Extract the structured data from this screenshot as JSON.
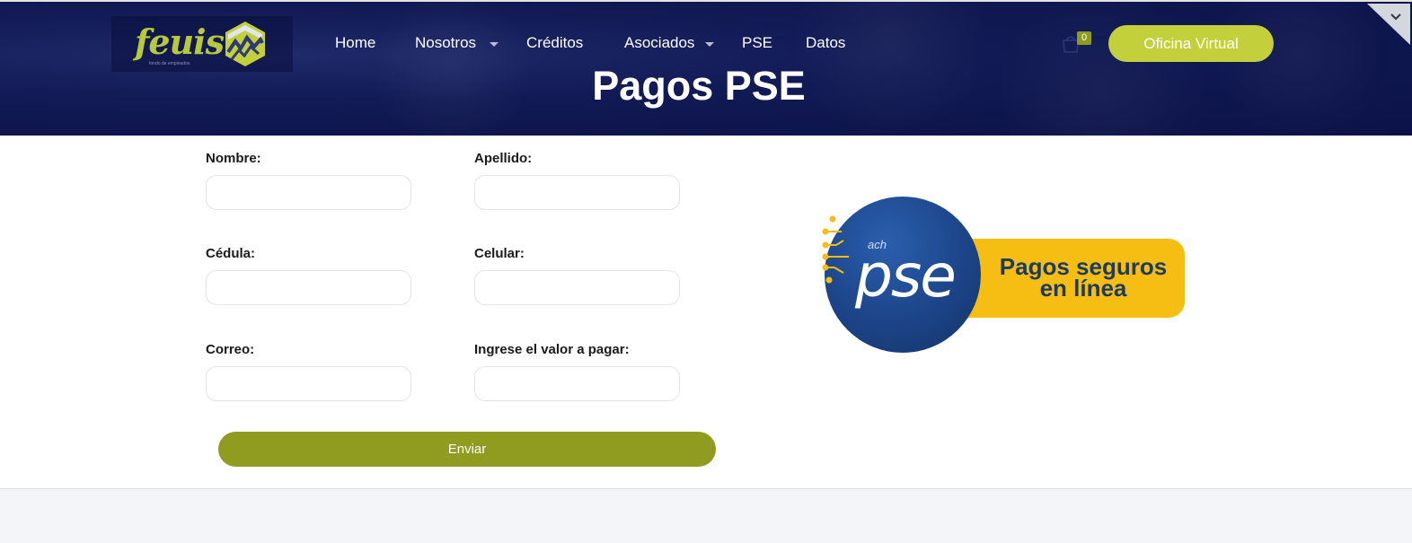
{
  "header": {
    "logo_text": "feuis",
    "logo_tagline": "fondo de empleados",
    "nav": [
      {
        "label": "Home",
        "has_dropdown": false
      },
      {
        "label": "Nosotros",
        "has_dropdown": true
      },
      {
        "label": "Créditos",
        "has_dropdown": false
      },
      {
        "label": "Asociados",
        "has_dropdown": true
      },
      {
        "label": "PSE",
        "has_dropdown": false
      },
      {
        "label": "Datos",
        "has_dropdown": false
      }
    ],
    "cart_count": "0",
    "oficina_label": "Oficina Virtual",
    "page_title": "Pagos PSE"
  },
  "form": {
    "nombre_label": "Nombre:",
    "apellido_label": "Apellido:",
    "cedula_label": "Cédula:",
    "celular_label": "Celular:",
    "correo_label": "Correo:",
    "valor_label": "Ingrese el valor a pagar:",
    "nombre_value": "",
    "apellido_value": "",
    "cedula_value": "",
    "celular_value": "",
    "correo_value": "",
    "valor_value": "",
    "submit_label": "Enviar"
  },
  "pse_banner": {
    "ach": "ach",
    "brand": "pse",
    "line1": "Pagos seguros",
    "line2": "en línea"
  },
  "colors": {
    "header_bg": "#0b1248",
    "accent_lime": "#c3cf3b",
    "submit_olive": "#909c20",
    "pse_yellow": "#f6bd13",
    "pse_blue": "#1c4488"
  },
  "icons": [
    "logo-mountain-icon",
    "chevron-down-icon",
    "shopping-bag-icon",
    "corner-toggle-icon"
  ]
}
